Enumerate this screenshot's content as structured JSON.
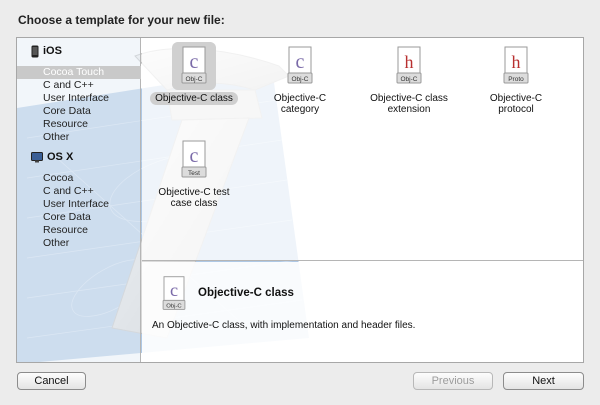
{
  "dialog": {
    "title": "Choose a template for your new file:"
  },
  "sidebar": {
    "platforms": [
      {
        "name": "iOS",
        "icon": "iphone-icon",
        "categories": [
          "Cocoa Touch",
          "C and C++",
          "User Interface",
          "Core Data",
          "Resource",
          "Other"
        ]
      },
      {
        "name": "OS X",
        "icon": "mac-icon",
        "categories": [
          "Cocoa",
          "C and C++",
          "User Interface",
          "Core Data",
          "Resource",
          "Other"
        ]
      }
    ],
    "selected": "Cocoa Touch"
  },
  "templates": [
    {
      "label": "Objective-C class",
      "icon_text": "Obj-C",
      "glyph": "c",
      "selected": true
    },
    {
      "label": "Objective-C category",
      "icon_text": "Obj-C",
      "glyph": "c",
      "selected": false
    },
    {
      "label": "Objective-C class extension",
      "icon_text": "Obj-C",
      "glyph": "h",
      "selected": false
    },
    {
      "label": "Objective-C protocol",
      "icon_text": "Proto",
      "glyph": "h",
      "selected": false
    },
    {
      "label": "Objective-C test case class",
      "icon_text": "Test",
      "glyph": "c",
      "selected": false
    }
  ],
  "description": {
    "title": "Objective-C class",
    "icon_text": "Obj-C",
    "text": "An Objective-C class, with implementation and header files."
  },
  "buttons": {
    "cancel": "Cancel",
    "previous": "Previous",
    "next": "Next"
  },
  "colors": {
    "selection": "#c9c9c9",
    "c_glyph": "#7a6aa8",
    "h_glyph": "#b83030",
    "blueprint": "#5b8fc9"
  }
}
